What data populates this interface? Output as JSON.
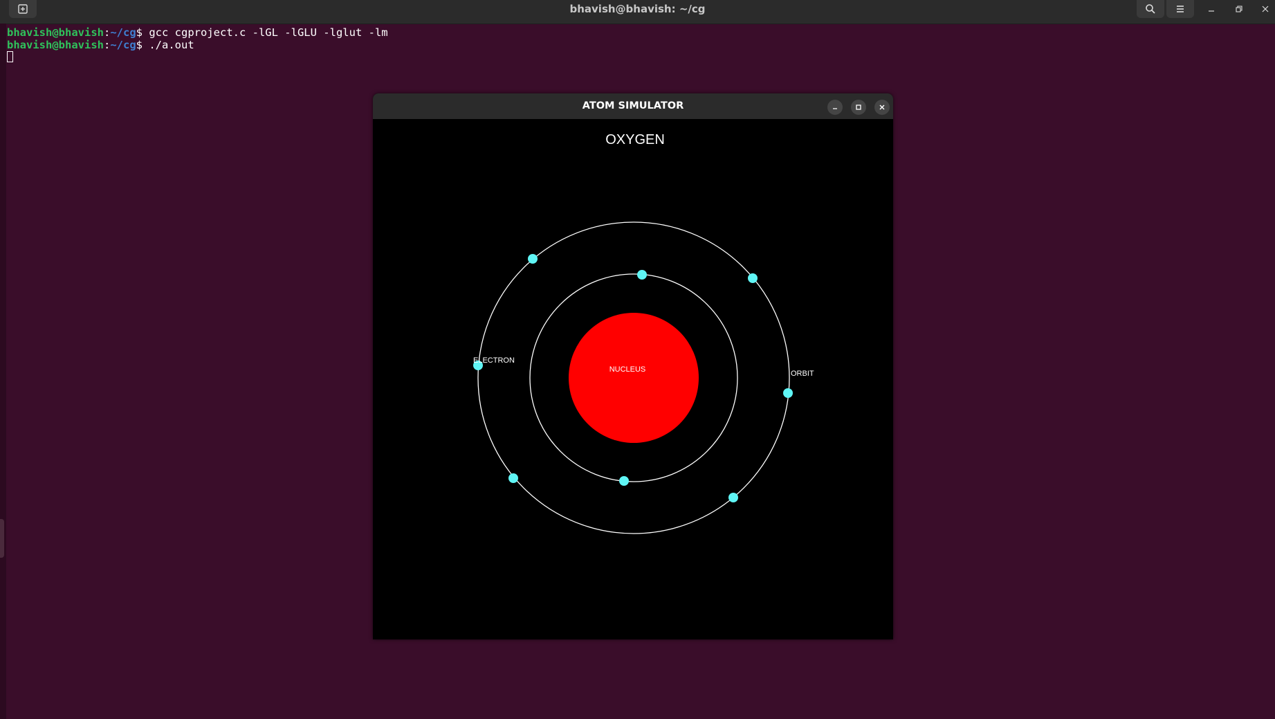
{
  "terminal": {
    "title": "bhavish@bhavish: ~/cg",
    "lines": [
      {
        "user": "bhavish@bhavish",
        "sep": ":",
        "path": "~/cg",
        "dollar": "$",
        "command": " gcc cgproject.c -lGL -lGLU -lglut -lm"
      },
      {
        "user": "bhavish@bhavish",
        "sep": ":",
        "path": "~/cg",
        "dollar": "$",
        "command": " ./a.out"
      }
    ],
    "colors": {
      "background": "#3a0d2a",
      "user": "#2fc25b",
      "path": "#3f7fd0"
    }
  },
  "app": {
    "title": "ATOM SIMULATOR",
    "element_name": "OXYGEN",
    "labels": {
      "nucleus": "NUCLEUS",
      "electron": "ELECTRON",
      "orbit": "ORBIT"
    },
    "colors": {
      "nucleus": "#ff0000",
      "electron": "#5ff5f5",
      "orbit": "#ffffff",
      "background": "#000000"
    },
    "electron_count": 8
  }
}
